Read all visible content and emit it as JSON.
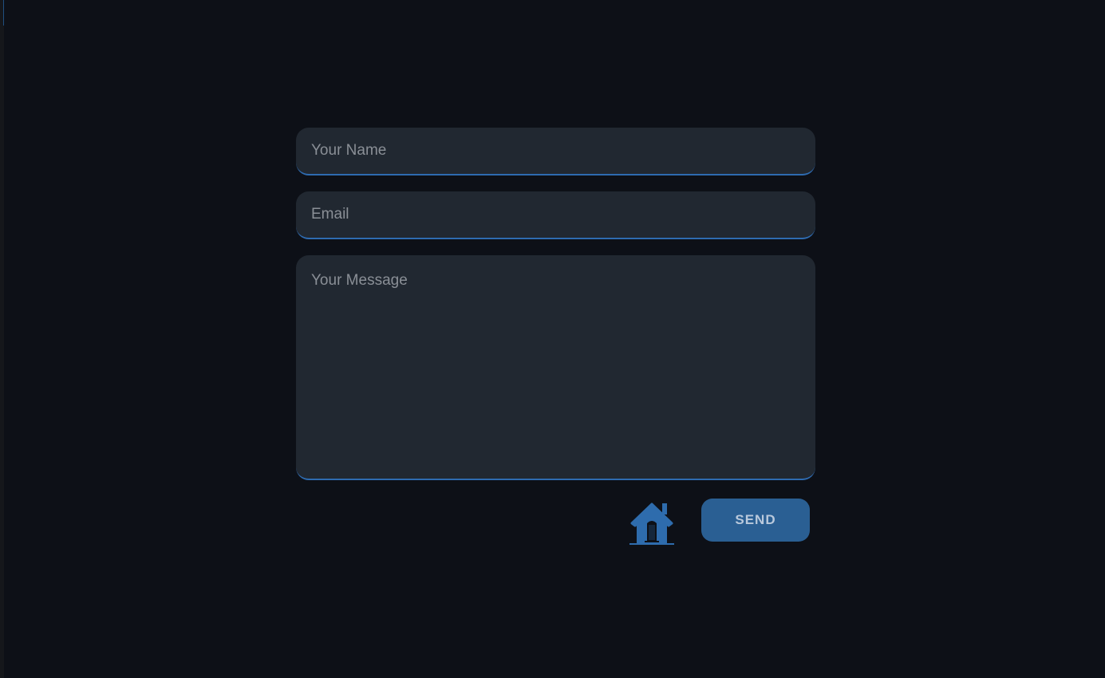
{
  "form": {
    "name_placeholder": "Your Name",
    "email_placeholder": "Email",
    "message_placeholder": "Your Message",
    "send_label": "SEND",
    "home_icon": "house-icon"
  },
  "colors": {
    "accent": "#2a5f93",
    "field_bg": "#212831",
    "background": "#0d1017"
  }
}
